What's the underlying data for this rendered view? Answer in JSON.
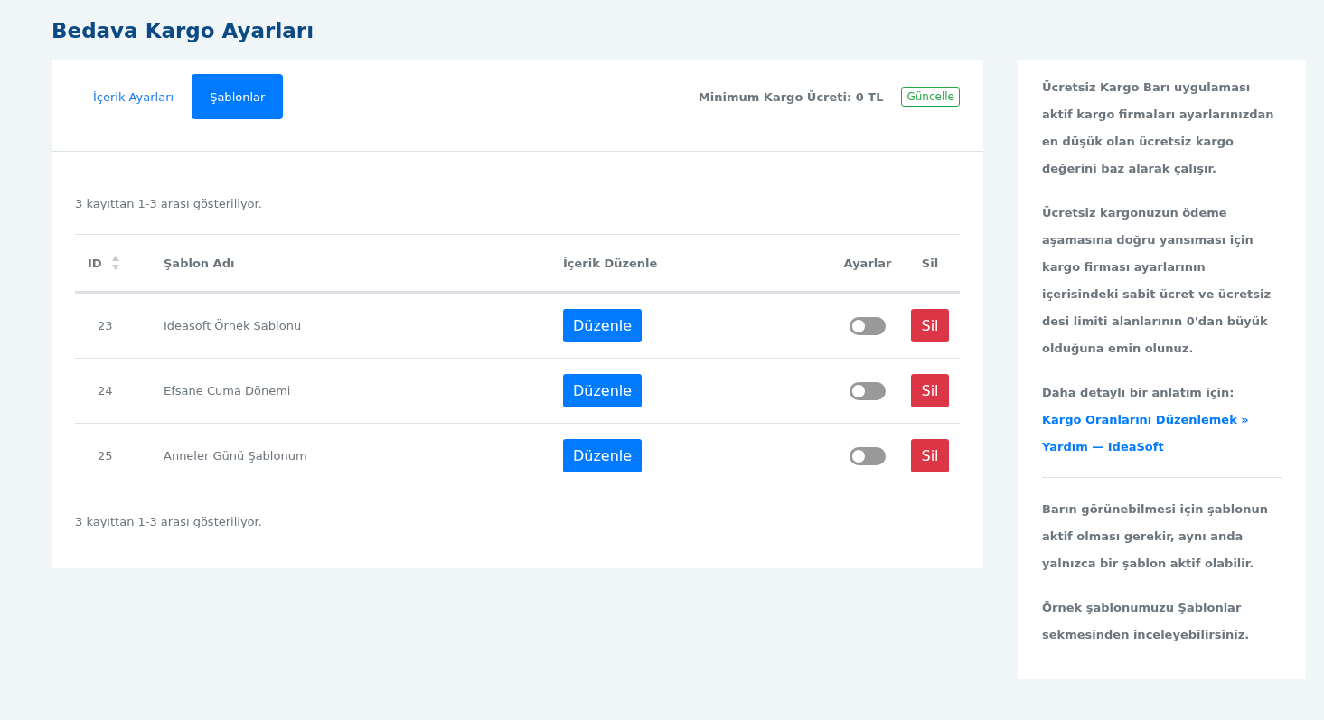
{
  "page_title": "Bedava Kargo Ayarları",
  "tabs": [
    {
      "label": "İçerik Ayarları",
      "selected": false
    },
    {
      "label": "Şablonlar",
      "selected": true
    }
  ],
  "min_shipping": "Minimum Kargo Ücreti: 0 TL",
  "update_button": "Güncelle",
  "summary_top": "3 kayıttan 1-3 arası gösteriliyor.",
  "table": {
    "columns": [
      "ID",
      "Şablon Adı",
      "İçerik Düzenle",
      "Ayarlar",
      "Sil"
    ],
    "rows": [
      {
        "id": "23",
        "name": "Ideasoft Örnek Şablonu",
        "edit": "Düzenle",
        "on": false,
        "delete": "Sil"
      },
      {
        "id": "24",
        "name": "Efsane Cuma Dönemi",
        "edit": "Düzenle",
        "on": false,
        "delete": "Sil"
      },
      {
        "id": "25",
        "name": "Anneler Günü Şablonum",
        "edit": "Düzenle",
        "on": false,
        "delete": "Sil"
      }
    ]
  },
  "summary_bottom": "3 kayıttan 1-3 arası gösteriliyor.",
  "sidebar": {
    "paragraphs_top": [
      "Ücretsiz Kargo Barı uygulaması aktif kargo firmaları ayarlarınızdan en düşük olan ücretsiz kargo değerini baz alarak çalışır.",
      "Ücretsiz kargonuzun ödeme aşamasına doğru yansıması için kargo firması ayarlarının içerisindeki sabit ücret ve ücretsiz desi limiti alanlarının 0'dan büyük olduğuna emin olunuz.",
      "Daha detaylı bir anlatım için:"
    ],
    "link": "Kargo Oranlarını Düzenlemek » Yardım — IdeaSoft",
    "paragraphs_bottom": [
      "Barın görünebilmesi için şablonun aktif olması gerekir, aynı anda yalnızca bir şablon aktif olabilir.",
      "Örnek şablonumuzu Şablonlar sekmesinden inceleyebilirsiniz."
    ]
  }
}
